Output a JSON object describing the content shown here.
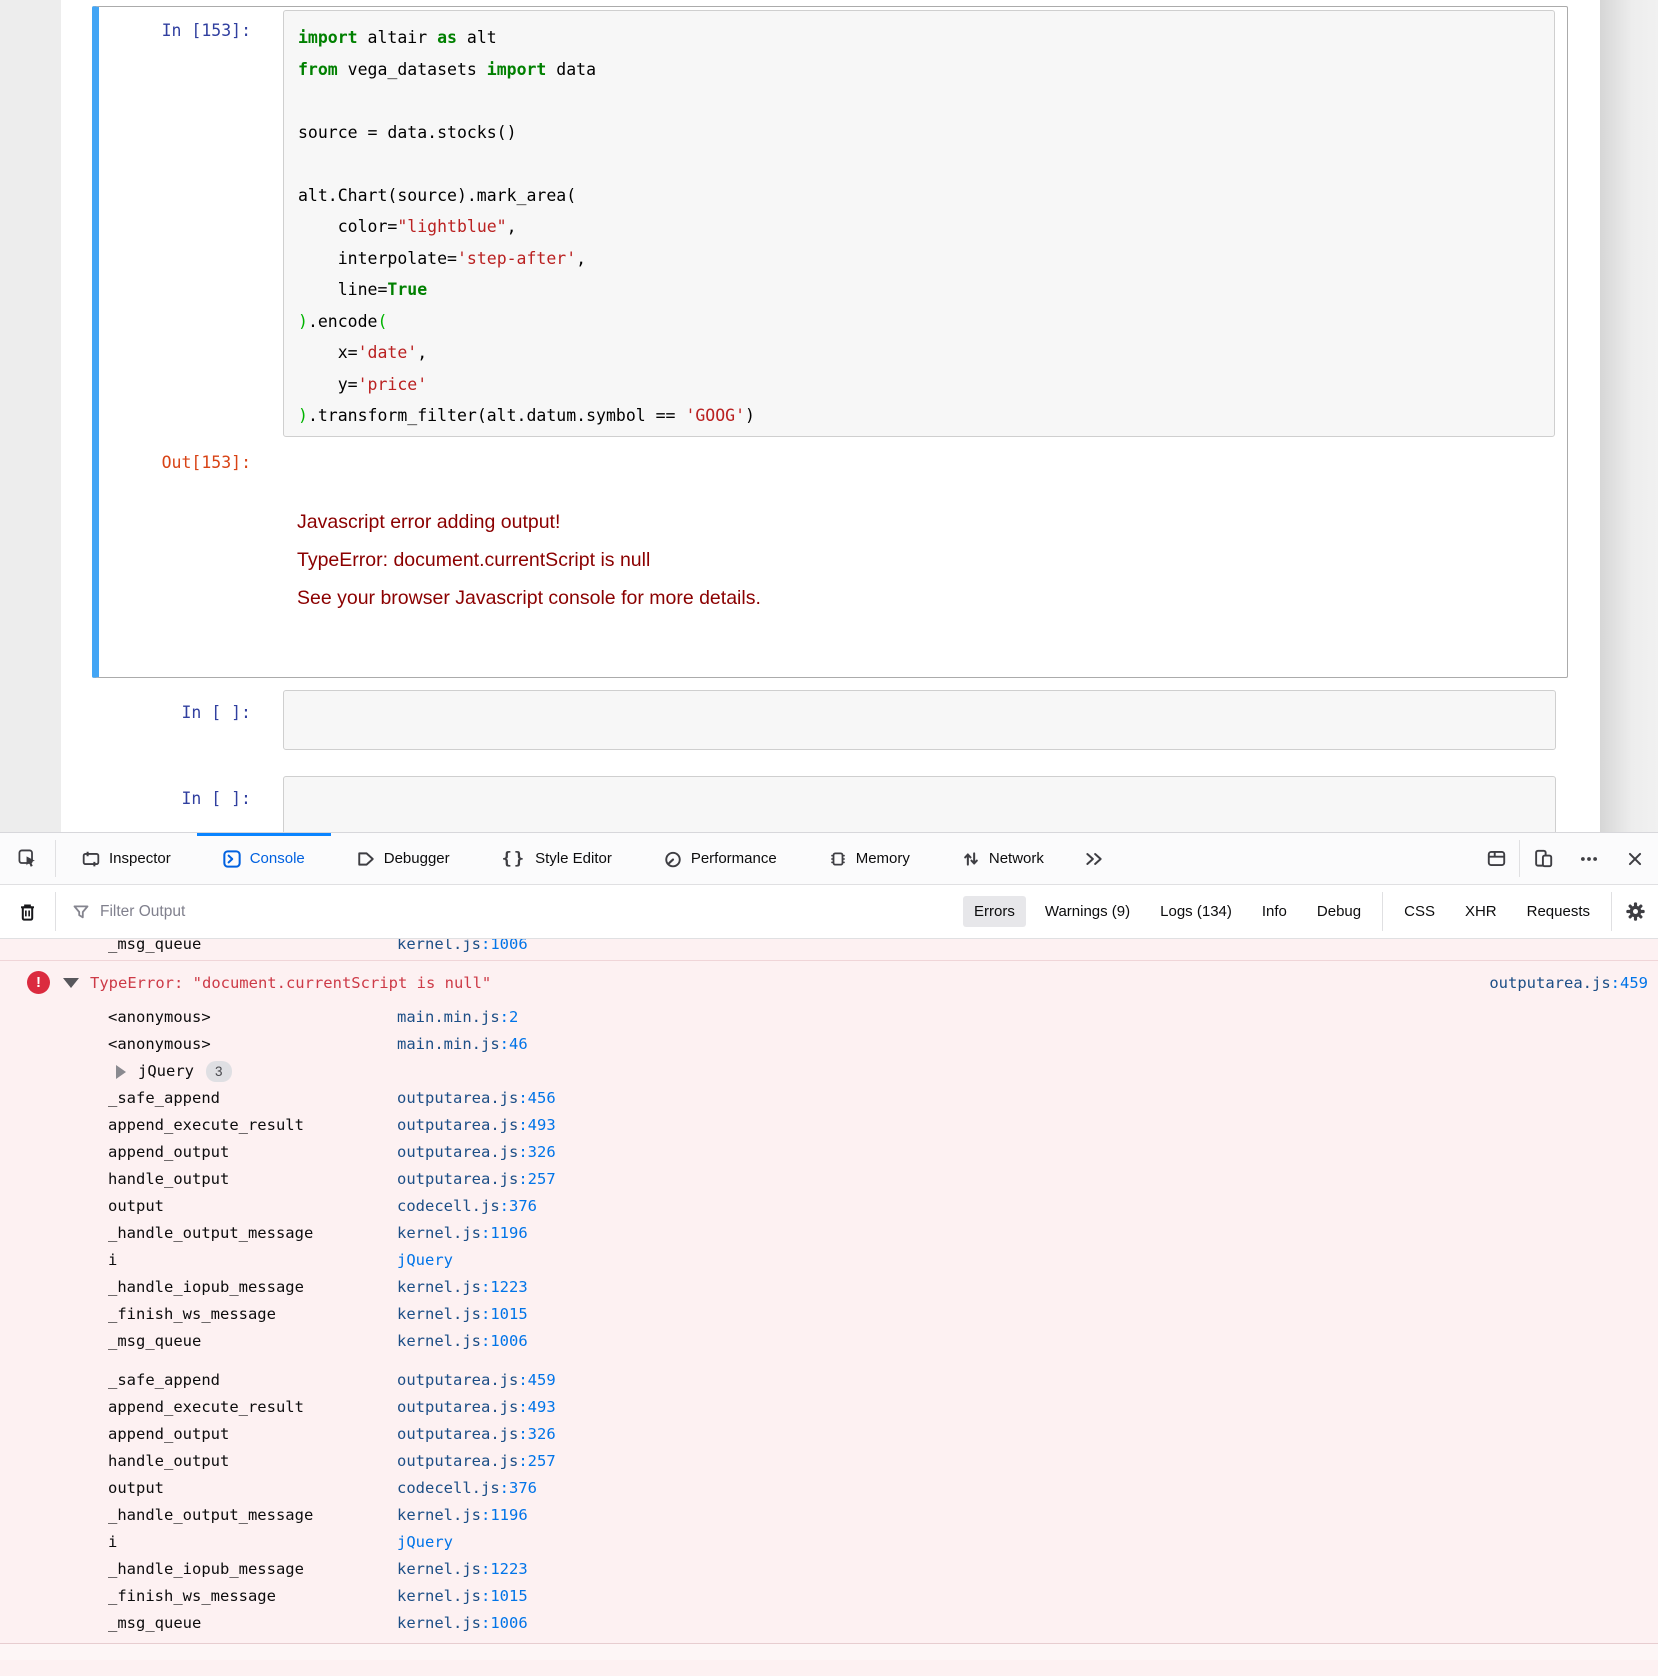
{
  "notebook": {
    "selected_cell": {
      "in_prompt": "In [153]:",
      "out_prompt": "Out[153]:",
      "code_lines": [
        [
          [
            "kw",
            "import"
          ],
          [
            "pl",
            " altair "
          ],
          [
            "kw",
            "as"
          ],
          [
            "pl",
            " alt"
          ]
        ],
        [
          [
            "kw",
            "from"
          ],
          [
            "pl",
            " vega_datasets "
          ],
          [
            "kw",
            "import"
          ],
          [
            "pl",
            " data"
          ]
        ],
        [],
        [
          [
            "pl",
            "source = data.stocks()"
          ]
        ],
        [],
        [
          [
            "pl",
            "alt.Chart(source).mark_area("
          ]
        ],
        [
          [
            "pl",
            "    color="
          ],
          [
            "str",
            "\"lightblue\""
          ],
          [
            "pl",
            ","
          ]
        ],
        [
          [
            "pl",
            "    interpolate="
          ],
          [
            "str",
            "'step-after'"
          ],
          [
            "pl",
            ","
          ]
        ],
        [
          [
            "pl",
            "    line="
          ],
          [
            "kw",
            "True"
          ]
        ],
        [
          [
            "br",
            ")"
          ],
          [
            "pl",
            ".encode"
          ],
          [
            "br",
            "("
          ]
        ],
        [
          [
            "pl",
            "    x="
          ],
          [
            "str",
            "'date'"
          ],
          [
            "pl",
            ","
          ]
        ],
        [
          [
            "pl",
            "    y="
          ],
          [
            "str",
            "'price'"
          ]
        ],
        [
          [
            "br",
            ")"
          ],
          [
            "pl",
            ".transform_filter(alt.datum.symbol == "
          ],
          [
            "str",
            "'GOOG'"
          ],
          [
            "pl",
            ")"
          ]
        ]
      ],
      "output_error_lines": [
        "Javascript error adding output!",
        "TypeError: document.currentScript is null",
        "See your browser Javascript console for more details."
      ]
    },
    "empty_cells": [
      {
        "prompt": "In [ ]:"
      },
      {
        "prompt": "In [ ]:"
      }
    ]
  },
  "devtools": {
    "tabs": [
      {
        "label": "Inspector",
        "active": false
      },
      {
        "label": "Console",
        "active": true
      },
      {
        "label": "Debugger",
        "active": false
      },
      {
        "label": "Style Editor",
        "active": false,
        "icon_glyph": "{}"
      },
      {
        "label": "Performance",
        "active": false
      },
      {
        "label": "Memory",
        "active": false
      },
      {
        "label": "Network",
        "active": false
      }
    ],
    "filter": {
      "placeholder": "Filter Output",
      "level_buttons": [
        {
          "label": "Errors",
          "active": true
        },
        {
          "label": "Warnings (9)",
          "active": false
        },
        {
          "label": "Logs (134)",
          "active": false
        },
        {
          "label": "Info",
          "active": false
        },
        {
          "label": "Debug",
          "active": false
        }
      ],
      "type_buttons": [
        {
          "label": "CSS",
          "active": false
        },
        {
          "label": "XHR",
          "active": false
        },
        {
          "label": "Requests",
          "active": false
        }
      ]
    },
    "console": {
      "clipped_row": {
        "fn": "_msg_queue",
        "file": "kernel.js",
        "line": "1006"
      },
      "error": {
        "icon_glyph": "!",
        "message": "TypeError: \"document.currentScript is null\"",
        "file": "outputarea.js",
        "line": "459"
      },
      "stack_primary": [
        {
          "fn": "<anonymous>",
          "file": "main.min.js",
          "line": "2"
        },
        {
          "fn": "<anonymous>",
          "file": "main.min.js",
          "line": "46"
        },
        {
          "group": "jQuery",
          "count": "3"
        },
        {
          "fn": "_safe_append",
          "file": "outputarea.js",
          "line": "456"
        },
        {
          "fn": "append_execute_result",
          "file": "outputarea.js",
          "line": "493"
        },
        {
          "fn": "append_output",
          "file": "outputarea.js",
          "line": "326"
        },
        {
          "fn": "handle_output",
          "file": "outputarea.js",
          "line": "257"
        },
        {
          "fn": "output",
          "file": "codecell.js",
          "line": "376"
        },
        {
          "fn": "_handle_output_message",
          "file": "kernel.js",
          "line": "1196"
        },
        {
          "fn": "i",
          "file": "jQuery",
          "plain": true
        },
        {
          "fn": "_handle_iopub_message",
          "file": "kernel.js",
          "line": "1223"
        },
        {
          "fn": "_finish_ws_message",
          "file": "kernel.js",
          "line": "1015"
        },
        {
          "fn": "_msg_queue",
          "file": "kernel.js",
          "line": "1006"
        }
      ],
      "stack_secondary": [
        {
          "fn": "_safe_append",
          "file": "outputarea.js",
          "line": "459"
        },
        {
          "fn": "append_execute_result",
          "file": "outputarea.js",
          "line": "493"
        },
        {
          "fn": "append_output",
          "file": "outputarea.js",
          "line": "326"
        },
        {
          "fn": "handle_output",
          "file": "outputarea.js",
          "line": "257"
        },
        {
          "fn": "output",
          "file": "codecell.js",
          "line": "376"
        },
        {
          "fn": "_handle_output_message",
          "file": "kernel.js",
          "line": "1196"
        },
        {
          "fn": "i",
          "file": "jQuery",
          "plain": true
        },
        {
          "fn": "_handle_iopub_message",
          "file": "kernel.js",
          "line": "1223"
        },
        {
          "fn": "_finish_ws_message",
          "file": "kernel.js",
          "line": "1015"
        },
        {
          "fn": "_msg_queue",
          "file": "kernel.js",
          "line": "1006"
        }
      ]
    }
  },
  "colors": {
    "accent_blue": "#0a84ff",
    "tab_active_blue": "#0061e0",
    "selected_cell_blue": "#42a5f5",
    "in_prompt_navy": "#303f9f",
    "out_prompt_orange": "#d84315",
    "keyword_green": "#008000",
    "string_red": "#ba2121",
    "matching_bracket_green": "#00b400",
    "js_error_darkred": "#8b0000",
    "console_error_bg": "#fdf1f2",
    "console_error_text": "#cd3a47",
    "error_icon_red": "#db2b3f",
    "link_file_blue": "#1c4e86",
    "link_line_blue": "#0074e8"
  }
}
